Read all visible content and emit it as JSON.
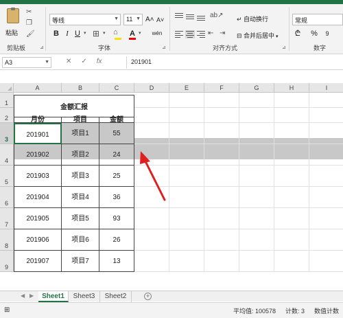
{
  "ribbon": {
    "clipboard": {
      "paste_label": "粘贴",
      "group_label": "剪贴板"
    },
    "font": {
      "name": "等线",
      "size": "11",
      "group_label": "字体",
      "bold": "B",
      "italic": "I",
      "underline": "U",
      "font_color_label": "A",
      "grow": "A˄",
      "shrink": "A˅",
      "phonetic": "wén"
    },
    "alignment": {
      "wrap_label": "自动换行",
      "merge_label": "合并后居中",
      "group_label": "对齐方式"
    },
    "number": {
      "format": "常规",
      "group_label": "数字",
      "currency": "₾",
      "percent": "%",
      "comma": "9"
    }
  },
  "formula_bar": {
    "name_box": "A3",
    "fx": "fx",
    "value": "201901"
  },
  "grid": {
    "columns": [
      "A",
      "B",
      "C",
      "D",
      "E",
      "F",
      "G",
      "H",
      "I"
    ],
    "rows": [
      "1",
      "2",
      "3",
      "4",
      "5",
      "6",
      "7",
      "8",
      "9"
    ],
    "title": "金额汇报",
    "headers": [
      "月份",
      "项目",
      "金额"
    ],
    "data": [
      [
        "201901",
        "项目1",
        "55"
      ],
      [
        "201902",
        "项目2",
        "24"
      ],
      [
        "201903",
        "项目3",
        "25"
      ],
      [
        "201904",
        "项目4",
        "36"
      ],
      [
        "201905",
        "项目5",
        "93"
      ],
      [
        "201906",
        "项目6",
        "26"
      ],
      [
        "201907",
        "项目7",
        "13"
      ]
    ]
  },
  "sheets": [
    "Sheet1",
    "Sheet3",
    "Sheet2"
  ],
  "status": {
    "average": "平均值: 100578",
    "count": "计数: 3",
    "numcount": "数值计数"
  },
  "colors": {
    "accent": "#217346",
    "arrow": "#e02020"
  }
}
